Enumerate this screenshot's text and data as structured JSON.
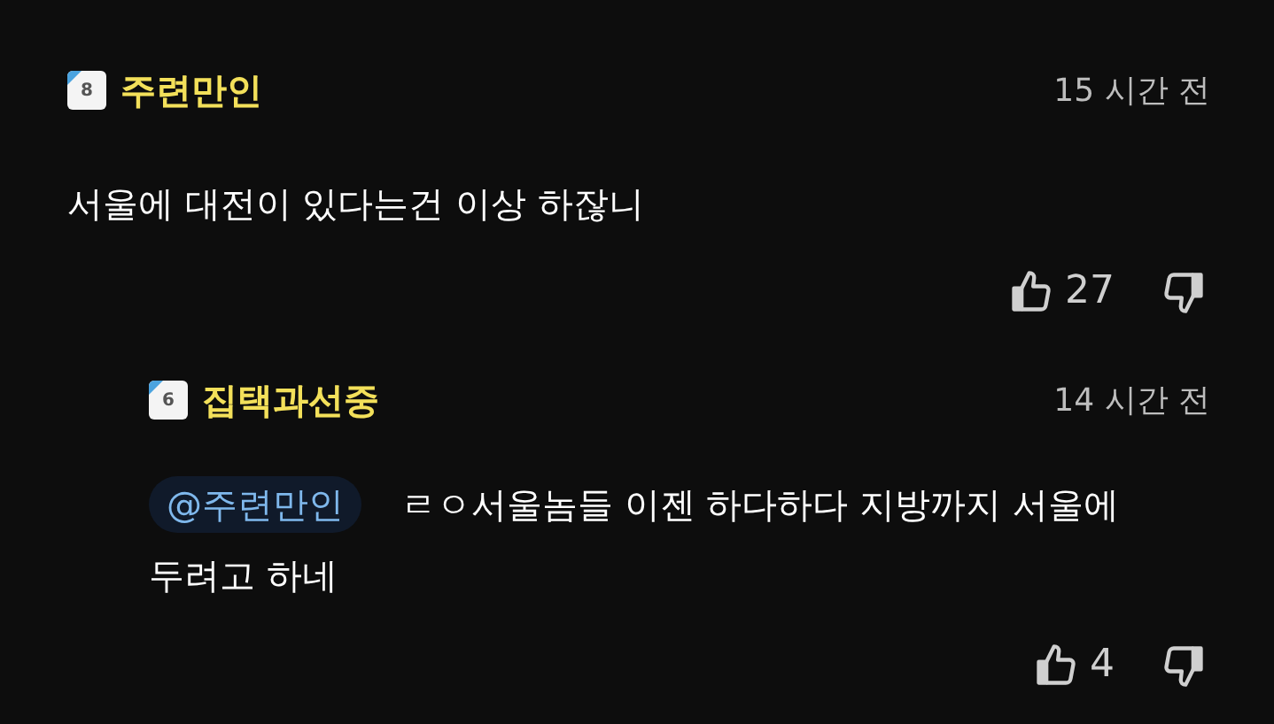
{
  "comments": [
    {
      "badge": "8",
      "author": "주련만인",
      "time": "15 시간 전",
      "body": "서울에 대전이 있다는건 이상 하잖니",
      "likes": "27",
      "replies": [
        {
          "badge": "6",
          "author": "집택과선중",
          "time": "14 시간 전",
          "mention": "@주련만인",
          "body": "ㄹㅇ서울놈들 이젠 하다하다 지방까지 서울에 두려고 하네",
          "likes": "4"
        }
      ]
    }
  ]
}
